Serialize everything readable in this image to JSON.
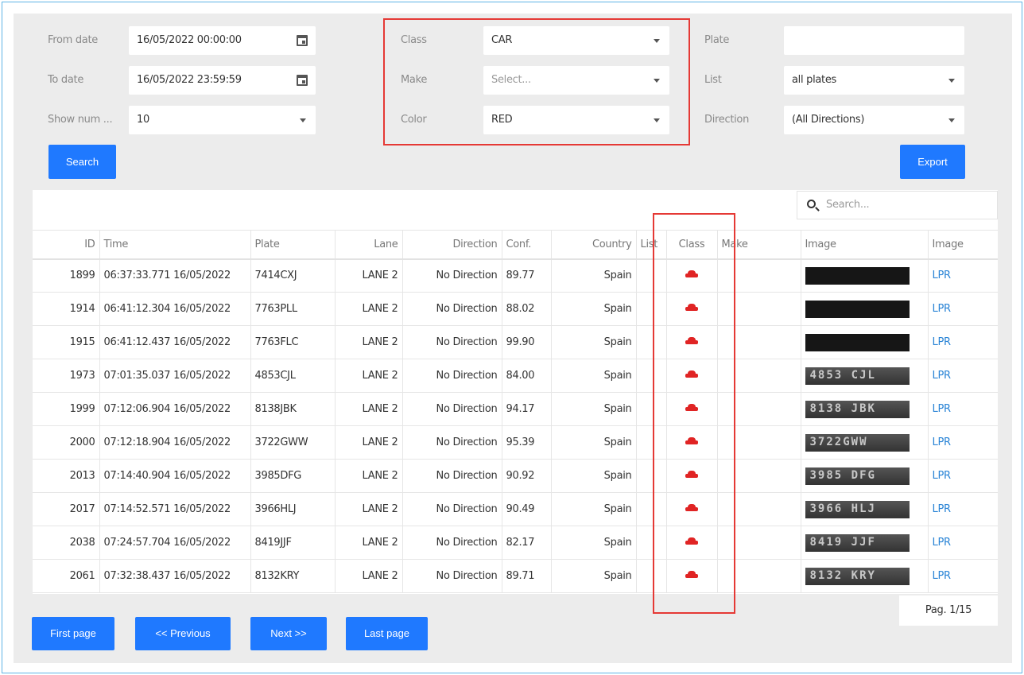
{
  "filters": {
    "from_date": {
      "label": "From date",
      "value": "16/05/2022 00:00:00"
    },
    "to_date": {
      "label": "To date",
      "value": "16/05/2022 23:59:59"
    },
    "show_num": {
      "label": "Show num ...",
      "value": "10"
    },
    "class": {
      "label": "Class",
      "value": "CAR"
    },
    "make": {
      "label": "Make",
      "placeholder": "Select..."
    },
    "color": {
      "label": "Color",
      "value": "RED"
    },
    "plate": {
      "label": "Plate",
      "value": ""
    },
    "list": {
      "label": "List",
      "value": "all plates"
    },
    "direction": {
      "label": "Direction",
      "value": "(All Directions)"
    }
  },
  "buttons": {
    "search": "Search",
    "export": "Export"
  },
  "table": {
    "search_placeholder": "Search...",
    "columns": [
      "ID",
      "Time",
      "Plate",
      "Lane",
      "Direction",
      "Conf.",
      "Country",
      "List",
      "Class",
      "Make",
      "Image",
      "Image"
    ],
    "rows": [
      {
        "id": "1899",
        "time": "06:37:33.771 16/05/2022",
        "plate": "7414CXJ",
        "lane": "LANE 2",
        "direction": "No Direction",
        "conf": "89.77",
        "country": "Spain",
        "list": "",
        "make": "",
        "plate_text": "",
        "link": "LPR"
      },
      {
        "id": "1914",
        "time": "06:41:12.304 16/05/2022",
        "plate": "7763PLL",
        "lane": "LANE 2",
        "direction": "No Direction",
        "conf": "88.02",
        "country": "Spain",
        "list": "",
        "make": "",
        "plate_text": "",
        "link": "LPR"
      },
      {
        "id": "1915",
        "time": "06:41:12.437 16/05/2022",
        "plate": "7763FLC",
        "lane": "LANE 2",
        "direction": "No Direction",
        "conf": "99.90",
        "country": "Spain",
        "list": "",
        "make": "",
        "plate_text": "",
        "link": "LPR"
      },
      {
        "id": "1973",
        "time": "07:01:35.037 16/05/2022",
        "plate": "4853CJL",
        "lane": "LANE 2",
        "direction": "No Direction",
        "conf": "84.00",
        "country": "Spain",
        "list": "",
        "make": "",
        "plate_text": "4853 CJL",
        "link": "LPR"
      },
      {
        "id": "1999",
        "time": "07:12:06.904 16/05/2022",
        "plate": "8138JBK",
        "lane": "LANE 2",
        "direction": "No Direction",
        "conf": "94.17",
        "country": "Spain",
        "list": "",
        "make": "",
        "plate_text": "8138 JBK",
        "link": "LPR"
      },
      {
        "id": "2000",
        "time": "07:12:18.904 16/05/2022",
        "plate": "3722GWW",
        "lane": "LANE 2",
        "direction": "No Direction",
        "conf": "95.39",
        "country": "Spain",
        "list": "",
        "make": "",
        "plate_text": "3722GWW",
        "link": "LPR"
      },
      {
        "id": "2013",
        "time": "07:14:40.904 16/05/2022",
        "plate": "3985DFG",
        "lane": "LANE 2",
        "direction": "No Direction",
        "conf": "90.92",
        "country": "Spain",
        "list": "",
        "make": "",
        "plate_text": "3985 DFG",
        "link": "LPR"
      },
      {
        "id": "2017",
        "time": "07:14:52.571 16/05/2022",
        "plate": "3966HLJ",
        "lane": "LANE 2",
        "direction": "No Direction",
        "conf": "90.49",
        "country": "Spain",
        "list": "",
        "make": "",
        "plate_text": "3966 HLJ",
        "link": "LPR"
      },
      {
        "id": "2038",
        "time": "07:24:57.704 16/05/2022",
        "plate": "8419JJF",
        "lane": "LANE 2",
        "direction": "No Direction",
        "conf": "82.17",
        "country": "Spain",
        "list": "",
        "make": "",
        "plate_text": "8419 JJF",
        "link": "LPR"
      },
      {
        "id": "2061",
        "time": "07:32:38.437 16/05/2022",
        "plate": "8132KRY",
        "lane": "LANE 2",
        "direction": "No Direction",
        "conf": "89.71",
        "country": "Spain",
        "list": "",
        "make": "",
        "plate_text": "8132 KRY",
        "link": "LPR"
      }
    ],
    "class_icon": "car-icon",
    "class_icon_color": "#e02424"
  },
  "pagination": {
    "first": "First page",
    "previous": "<< Previous",
    "next": "Next >>",
    "last": "Last page",
    "page_info": "Pag. 1/15"
  },
  "colors": {
    "accent": "#1f79ff",
    "highlight_box": "#e53935",
    "link": "#2a84d6"
  }
}
